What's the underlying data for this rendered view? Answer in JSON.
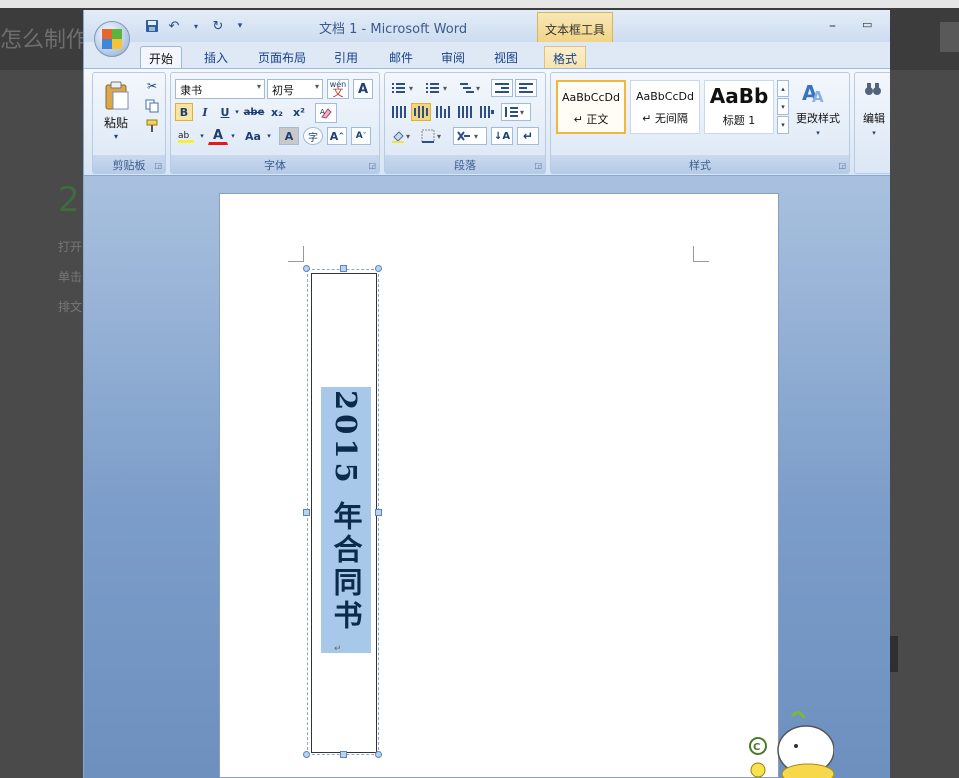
{
  "background": {
    "article_title": "怎么制作",
    "step_number": "2",
    "line_1": "打开",
    "line_2": "单击",
    "line_3": "排文"
  },
  "window": {
    "title": "文档 1 - Microsoft Word",
    "context_tool": "文本框工具",
    "minimize": "–",
    "maximize": "▭"
  },
  "tabs": [
    "开始",
    "插入",
    "页面布局",
    "引用",
    "邮件",
    "审阅",
    "视图",
    "格式"
  ],
  "clipboard": {
    "paste": "粘贴",
    "group": "剪贴板"
  },
  "font": {
    "name": "隶书",
    "size": "初号",
    "group": "字体",
    "bold": "B",
    "italic": "I",
    "underline": "U",
    "strike": "abe",
    "subscript": "x₂",
    "superscript": "x²",
    "change_case": "Aa",
    "grow": "A",
    "shrink": "A",
    "char_border": "A",
    "font_color": "A",
    "wen": "wén",
    "wen_char": "文",
    "enclosed": "字"
  },
  "paragraph": {
    "group": "段落",
    "sort": "↓A",
    "show_marks": "↵"
  },
  "styles": {
    "group": "样式",
    "items": [
      {
        "sample": "AaBbCcDd",
        "name": "↵ 正文"
      },
      {
        "sample": "AaBbCcDd",
        "name": "↵ 无间隔"
      },
      {
        "sample": "AaBb",
        "name": "标题 1"
      }
    ],
    "change_styles": "更改样式"
  },
  "editing": {
    "label": "编辑"
  },
  "document": {
    "vertical_text": "2015 年合同书",
    "para_mark": "↵"
  },
  "colors": {
    "accent": "#2a5697",
    "highlight": "#a8c8ea",
    "context": "#f1d485"
  }
}
